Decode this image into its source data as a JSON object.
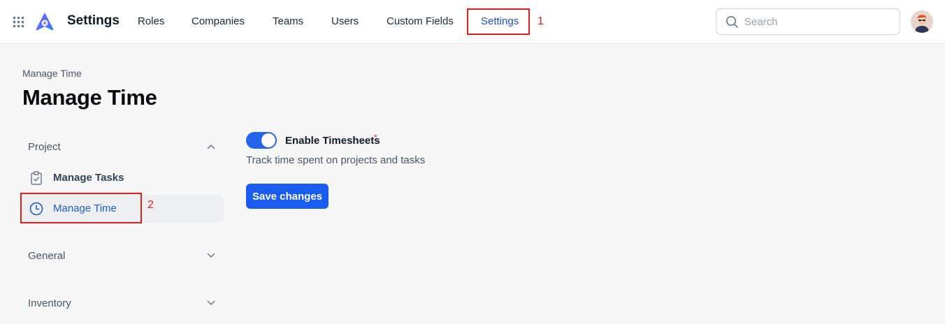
{
  "app": {
    "title": "Settings"
  },
  "nav": {
    "items": [
      {
        "label": "Roles"
      },
      {
        "label": "Companies"
      },
      {
        "label": "Teams"
      },
      {
        "label": "Users"
      },
      {
        "label": "Custom Fields"
      },
      {
        "label": "Settings",
        "active": true
      }
    ]
  },
  "annotations": {
    "marker1": "1",
    "marker2": "2",
    "highlight_color": "#e11d1d"
  },
  "search": {
    "placeholder": "Search",
    "value": ""
  },
  "page": {
    "breadcrumb": "Manage Time",
    "title": "Manage Time"
  },
  "sidebar": {
    "sections": [
      {
        "label": "Project",
        "expanded": true,
        "icon": "chevron-up-icon"
      },
      {
        "label": "General",
        "expanded": false,
        "icon": "chevron-down-icon"
      },
      {
        "label": "Inventory",
        "expanded": false,
        "icon": "chevron-down-icon"
      }
    ],
    "items": [
      {
        "label": "Manage Tasks",
        "icon": "clipboard-check-icon",
        "active": false
      },
      {
        "label": "Manage Time",
        "icon": "clock-icon",
        "active": true
      }
    ]
  },
  "timesheets": {
    "label": "Enable Timesheets",
    "required_mark": "*",
    "enabled": true,
    "helper": "Track time spent on projects and tasks"
  },
  "actions": {
    "save_label": "Save changes"
  },
  "colors": {
    "accent": "#1a5cf0",
    "active_text": "#1d4ed8",
    "required": "#dc2626"
  }
}
